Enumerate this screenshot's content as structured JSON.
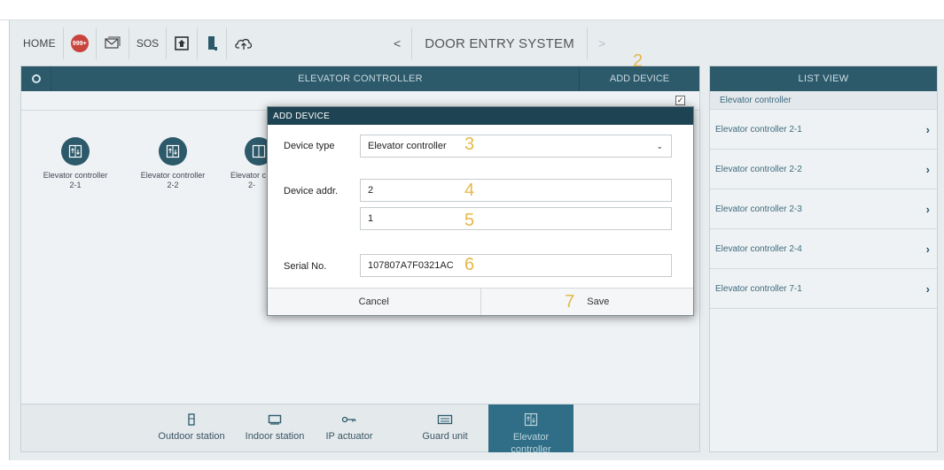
{
  "topbar": {
    "home": "HOME",
    "badge": "999+",
    "sos": "SOS",
    "icons": [
      "mail-icon",
      "house-up-icon",
      "door-icon",
      "cloud-upload-icon"
    ]
  },
  "nav": {
    "back": "<",
    "title": "DOOR ENTRY SYSTEM",
    "forward": ">"
  },
  "left_panel": {
    "title": "ELEVATOR CONTROLLER",
    "add_device": "ADD DEVICE",
    "check": "✓",
    "devices": [
      {
        "line1": "Elevator controller",
        "line2": "2-1"
      },
      {
        "line1": "Elevator controller",
        "line2": "2-2"
      },
      {
        "line1": "Elevator c",
        "line2": "2-"
      }
    ]
  },
  "markers": {
    "m2": "2",
    "m3": "3",
    "m4": "4",
    "m5": "5",
    "m6": "6",
    "m7": "7"
  },
  "dialog": {
    "title": "ADD DEVICE",
    "device_type_label": "Device type",
    "device_type_value": "Elevator controller",
    "device_addr_label": "Device addr.",
    "addr1": "2",
    "addr2": "1",
    "serial_label": "Serial No.",
    "serial_value": "107807A7F0321AC",
    "cancel": "Cancel",
    "save": "Save"
  },
  "tabs": [
    {
      "label": "Outdoor station",
      "icon": "outdoor-station-icon"
    },
    {
      "label": "Indoor station",
      "icon": "indoor-station-icon"
    },
    {
      "label": "IP actuator",
      "icon": "key-icon"
    },
    {
      "label": "Guard unit",
      "icon": "guard-unit-icon"
    },
    {
      "label": "Elevator controller",
      "icon": "elevator-icon"
    }
  ],
  "list_view": {
    "title": "LIST VIEW",
    "group": "Elevator controller",
    "items": [
      "Elevator controller 2-1",
      "Elevator controller 2-2",
      "Elevator controller 2-3",
      "Elevator controller 2-4",
      "Elevator controller 7-1"
    ]
  },
  "colors": {
    "header": "#2c5a6b",
    "dialog_header": "#1e4453",
    "marker": "#e5b84a",
    "active_tab": "#2f6e86"
  }
}
